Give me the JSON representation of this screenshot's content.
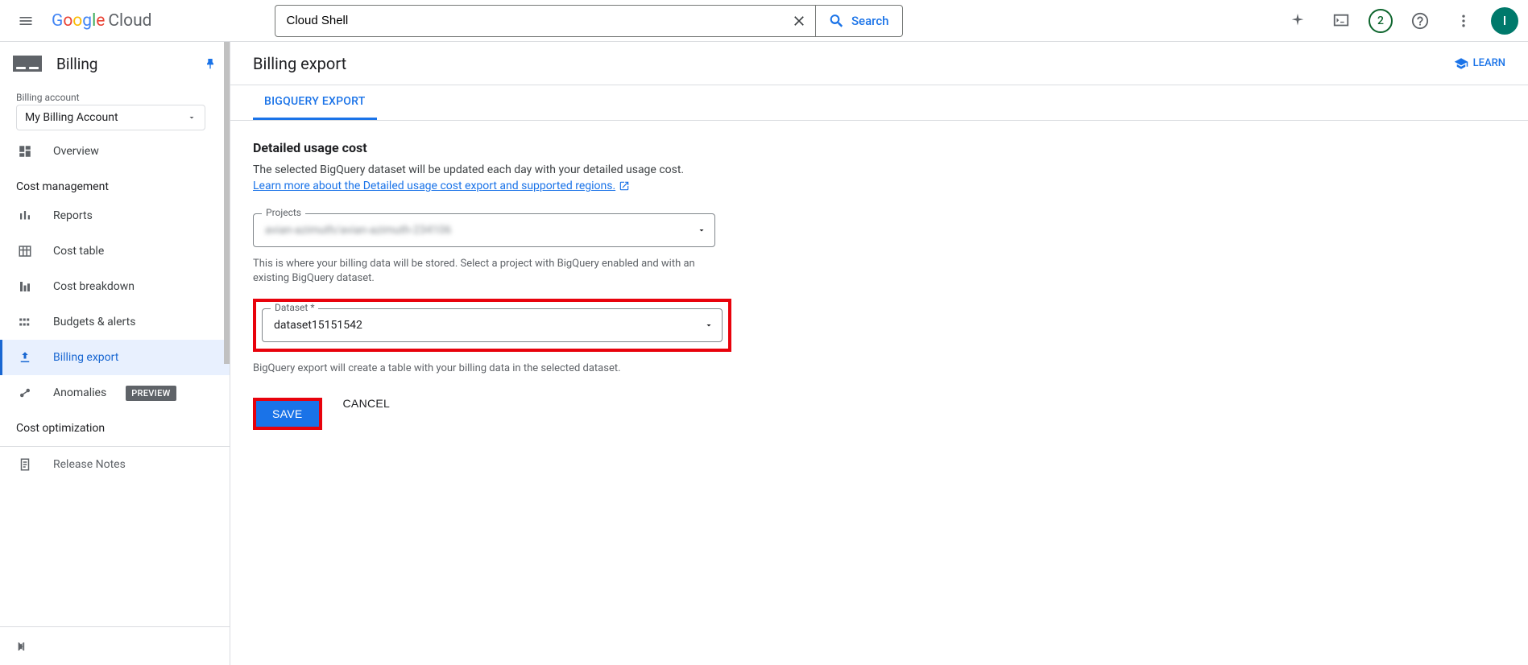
{
  "topbar": {
    "search_value": "Cloud Shell",
    "search_button": "Search",
    "notification_count": "2",
    "avatar_initial": "I",
    "logo_text": "Google",
    "logo_suffix": " Cloud"
  },
  "sidebar": {
    "title": "Billing",
    "account_label": "Billing account",
    "account_value": "My Billing Account",
    "items": [
      {
        "label": "Overview",
        "icon": "dashboard"
      },
      {
        "label": "Reports",
        "icon": "bar"
      },
      {
        "label": "Cost table",
        "icon": "table"
      },
      {
        "label": "Cost breakdown",
        "icon": "breakdown"
      },
      {
        "label": "Budgets & alerts",
        "icon": "budgets"
      },
      {
        "label": "Billing export",
        "icon": "upload",
        "active": true
      },
      {
        "label": "Anomalies",
        "icon": "anomaly",
        "chip": "PREVIEW"
      }
    ],
    "group_cost_mgmt": "Cost management",
    "group_cost_opt": "Cost optimization",
    "release_notes": "Release Notes"
  },
  "main": {
    "title": "Billing export",
    "learn_btn": "LEARN",
    "tab_bq": "BIGQUERY EXPORT",
    "section_title": "Detailed usage cost",
    "section_desc": "The selected BigQuery dataset will be updated each day with your detailed usage cost.",
    "learn_link": "Learn more about the Detailed usage cost export and supported regions.",
    "projects_label": "Projects",
    "projects_value": "avian-azimuth/avian-azimuth-234106",
    "projects_helper": "This is where your billing data will be stored. Select a project with BigQuery enabled and with an existing BigQuery dataset.",
    "dataset_label": "Dataset *",
    "dataset_value": "dataset15151542",
    "dataset_helper": "BigQuery export will create a table with your billing data in the selected dataset.",
    "save_btn": "SAVE",
    "cancel_btn": "CANCEL"
  }
}
